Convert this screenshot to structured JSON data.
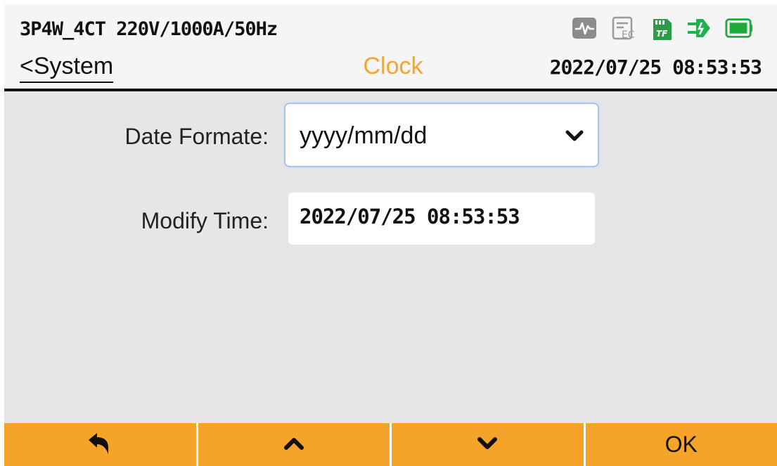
{
  "header": {
    "config": "3P4W_4CT 220V/1000A/50Hz",
    "back_label": "<System",
    "title": "Clock",
    "datetime": "2022/07/25 08:53:53",
    "status_icons": [
      "waveform-icon",
      "report-icon",
      "tf-card-icon",
      "power-plug-icon",
      "battery-icon"
    ],
    "tf_label": "TF"
  },
  "form": {
    "date_format_label": "Date Formate:",
    "date_format_value": "yyyy/mm/dd",
    "modify_time_label": "Modify Time:",
    "modify_time_value": "2022/07/25 08:53:53"
  },
  "footer": {
    "buttons": [
      "return-icon",
      "up-icon",
      "down-icon"
    ],
    "ok_label": "OK"
  },
  "colors": {
    "accent": "#f6a429",
    "title": "#f4a52b",
    "tf_green": "#2e9b47",
    "plug_green": "#22b14c",
    "battery_green": "#1faa3c",
    "icon_gray": "#8c8c8c"
  }
}
